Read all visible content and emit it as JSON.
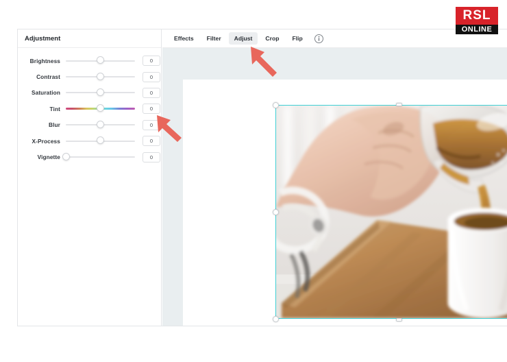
{
  "logo": {
    "line1": "RSL",
    "line2": "ONLINE",
    "red": "#d8232a",
    "black": "#111111"
  },
  "panel": {
    "title": "Adjustment",
    "sliders": [
      {
        "label": "Brightness",
        "value": "0",
        "position": 50,
        "type": "plain"
      },
      {
        "label": "Contrast",
        "value": "0",
        "position": 50,
        "type": "plain"
      },
      {
        "label": "Saturation",
        "value": "0",
        "position": 50,
        "type": "plain"
      },
      {
        "label": "Tint",
        "value": "0",
        "position": 50,
        "type": "gradient"
      },
      {
        "label": "Blur",
        "value": "0",
        "position": 50,
        "type": "plain"
      },
      {
        "label": "X-Process",
        "value": "0",
        "position": 50,
        "type": "plain"
      },
      {
        "label": "Vignette",
        "value": "0",
        "position": 0,
        "type": "plain"
      }
    ]
  },
  "toolbar": {
    "tabs": [
      {
        "label": "Effects",
        "active": false
      },
      {
        "label": "Filter",
        "active": false
      },
      {
        "label": "Adjust",
        "active": true
      },
      {
        "label": "Crop",
        "active": false
      },
      {
        "label": "Flip",
        "active": false
      }
    ],
    "info_icon": "info-icon"
  },
  "canvas": {
    "background": "#e9eef0",
    "selection_color": "#3ecfd4",
    "photo_alt": "Hand pouring coffee from a glass carafe into a white cup on a wooden board"
  },
  "annotations": [
    {
      "name": "arrow-to-adjust-tab",
      "color": "#e8675c"
    },
    {
      "name": "arrow-to-blur-slider",
      "color": "#e8675c"
    }
  ]
}
